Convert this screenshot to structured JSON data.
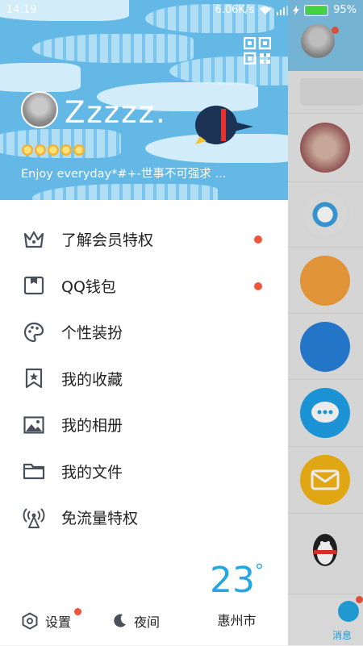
{
  "status_bar": {
    "time": "14:19",
    "speed": "6.06K/s",
    "battery": "95%"
  },
  "profile": {
    "nickname": "Zzzzz.",
    "signature": "Enjoy everyday*#+-世事不可强求 ...",
    "level_icons": [
      "sun-icon",
      "sun-icon",
      "sun-icon",
      "star-icon",
      "star-icon"
    ]
  },
  "menu": [
    {
      "label": "了解会员特权",
      "icon": "crown-icon",
      "dot": true
    },
    {
      "label": "QQ钱包",
      "icon": "wallet-icon",
      "dot": true
    },
    {
      "label": "个性装扮",
      "icon": "palette-icon",
      "dot": false
    },
    {
      "label": "我的收藏",
      "icon": "bookmark-icon",
      "dot": false
    },
    {
      "label": "我的相册",
      "icon": "image-icon",
      "dot": false
    },
    {
      "label": "我的文件",
      "icon": "folder-icon",
      "dot": false
    },
    {
      "label": "免流量特权",
      "icon": "signal-icon",
      "dot": false
    }
  ],
  "weather": {
    "temperature": "23",
    "unit": "°",
    "city": "惠州市"
  },
  "bottom": {
    "settings_label": "设置",
    "night_label": "夜间"
  },
  "background_app": {
    "tab_label": "消息"
  },
  "colors": {
    "accent": "#23a7e3",
    "badge_red": "#f2553e",
    "header_blue": "#63b8e6"
  }
}
